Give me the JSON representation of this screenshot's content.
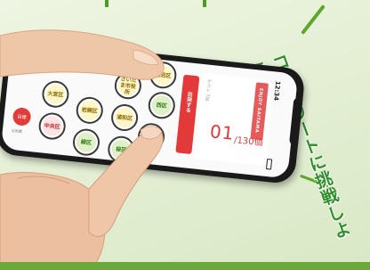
{
  "tagline": "コンプリートに挑戦しよう!",
  "phone": {
    "status_time": "12:34",
    "side_badge": "目標",
    "side_caption": "全制覇",
    "red_panel_label": "出発する",
    "info_small": "ゲスト 7区",
    "banner_text": "ENJOY SAITAMA",
    "count": "01",
    "count_total": "/130個"
  },
  "wards": [
    {
      "label": "中央区",
      "state": "red"
    },
    {
      "label": "大宮区",
      "state": "done"
    },
    {
      "label": "岩槻区",
      "state": "done"
    },
    {
      "label": "さいたま市役所",
      "state": "done"
    },
    {
      "label": "浦和区",
      "state": "done"
    },
    {
      "label": "緑区",
      "state": "green"
    },
    {
      "label": "南区",
      "state": "red"
    },
    {
      "label": "西区",
      "state": "green"
    },
    {
      "label": "桜区",
      "state": "green"
    },
    {
      "label": "見沼区",
      "state": "done"
    }
  ],
  "colors": {
    "accent_green": "#2f8f2a",
    "accent_red": "#e2393a",
    "band_green": "#6aa93a"
  }
}
